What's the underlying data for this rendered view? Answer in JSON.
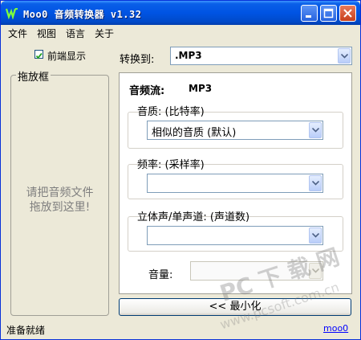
{
  "window": {
    "title": "Moo0 音频转换器 v1.32"
  },
  "menu": [
    "文件",
    "视图",
    "语言",
    "关于"
  ],
  "left": {
    "topmost_label": "前端显示",
    "topmost_checked": true,
    "dropzone_title": "拖放框",
    "dropzone_hint_line1": "请把音频文件",
    "dropzone_hint_line2": "拖放到这里!"
  },
  "convert": {
    "label": "转换到:",
    "value": ".MP3"
  },
  "stream": {
    "label": "音频流:",
    "value": "MP3"
  },
  "quality": {
    "label": "音质: (比特率)",
    "value": "相似的音质 (默认)"
  },
  "frequency": {
    "label": "频率: (采样率)",
    "value": ""
  },
  "channels": {
    "label": "立体声/单声道: (声道数)",
    "value": ""
  },
  "volume": {
    "label": "音量:",
    "value": ""
  },
  "minimize_button": "<< 最小化",
  "status": {
    "text": "准备就绪",
    "link": "moo0"
  },
  "watermark": {
    "line1": "PC 下 载 网",
    "line2": "www.pcsoft.com.cn"
  },
  "colors": {
    "titlebar": "#0054e3",
    "face": "#ece9d8",
    "border": "#7f9db9"
  }
}
